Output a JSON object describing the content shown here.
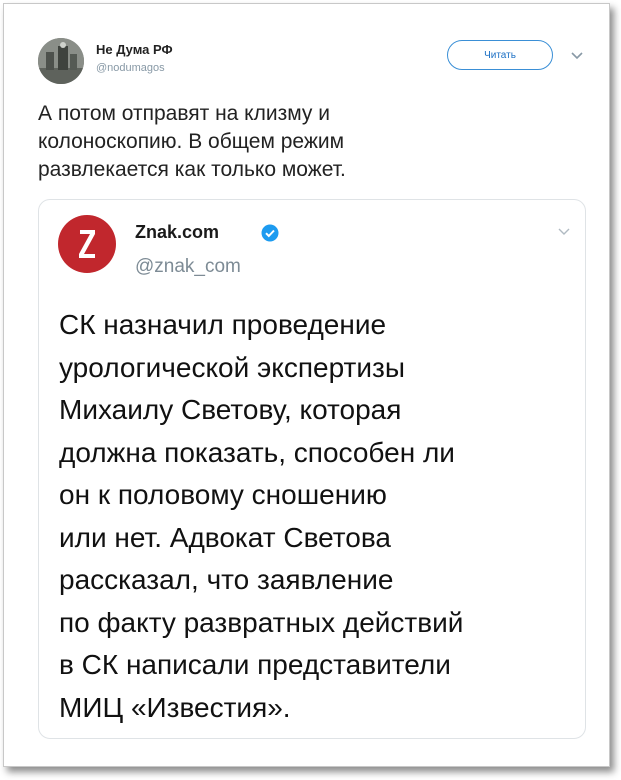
{
  "tweet": {
    "display_name": "Не Дума РФ",
    "handle": "@nodumagos",
    "follow_label": "Читать",
    "text": "А потом отправят на клизму и\nколоноскопию. В общем режим\nразвлекается как только может."
  },
  "quoted": {
    "display_name": "Znak.com",
    "handle": "@znak_com",
    "logo_letter": "Z",
    "text": "СК назначил проведение\nурологической экспертизы\nМихаилу Светову, которая\nдолжна показать, способен ли\nон к половому сношению\nили нет. Адвокат Светова\nрассказал, что заявление\nпо факту развратных действий\nв СК написали представители\nМИЦ «Известия»."
  },
  "colors": {
    "follow_accent": "#1b6fc4",
    "verified_badge": "#1d9bf0",
    "logo_red": "#c1272d"
  },
  "icons": [
    "caret-down-icon",
    "verified-badge-icon"
  ]
}
